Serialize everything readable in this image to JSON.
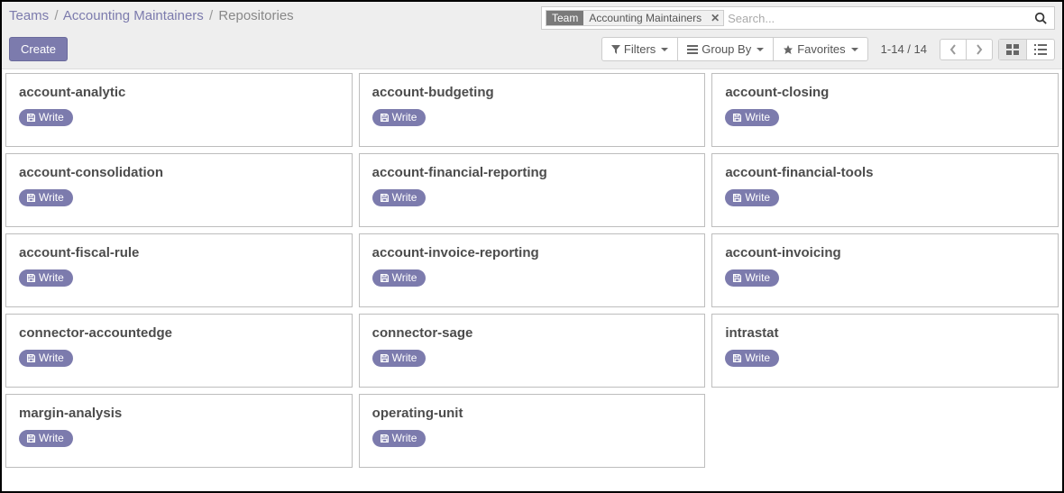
{
  "breadcrumb": {
    "root": "Teams",
    "team": "Accounting Maintainers",
    "current": "Repositories"
  },
  "search": {
    "facet_label": "Team",
    "facet_value": "Accounting Maintainers",
    "placeholder": "Search..."
  },
  "toolbar": {
    "create": "Create",
    "filters": "Filters",
    "group_by": "Group By",
    "favorites": "Favorites"
  },
  "pager": {
    "text": "1-14 / 14"
  },
  "card_action": "Write",
  "repos": [
    {
      "name": "account-analytic"
    },
    {
      "name": "account-budgeting"
    },
    {
      "name": "account-closing"
    },
    {
      "name": "account-consolidation"
    },
    {
      "name": "account-financial-reporting"
    },
    {
      "name": "account-financial-tools"
    },
    {
      "name": "account-fiscal-rule"
    },
    {
      "name": "account-invoice-reporting"
    },
    {
      "name": "account-invoicing"
    },
    {
      "name": "connector-accountedge"
    },
    {
      "name": "connector-sage"
    },
    {
      "name": "intrastat"
    },
    {
      "name": "margin-analysis"
    },
    {
      "name": "operating-unit"
    }
  ]
}
